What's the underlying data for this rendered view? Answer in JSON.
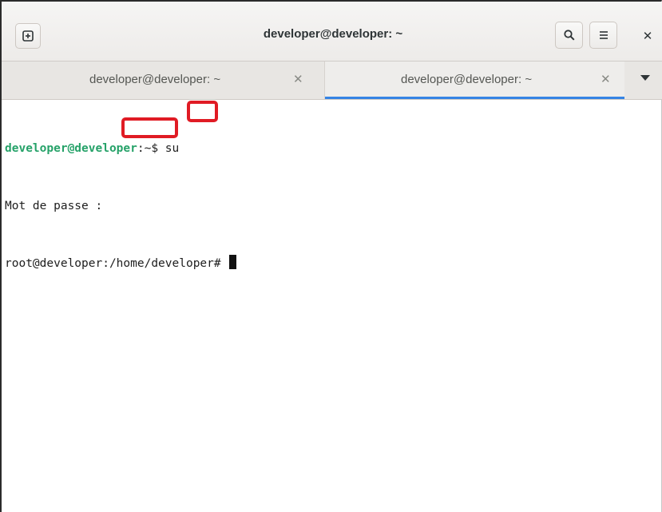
{
  "window": {
    "title": "developer@developer: ~"
  },
  "icons": {
    "new_tab": "new-tab-icon",
    "search": "search-icon",
    "menu": "hamburger-menu-icon",
    "close": "close-icon",
    "tab_close": "close-icon",
    "tab_list": "chevron-down-icon"
  },
  "tabs": [
    {
      "label": "developer@developer: ~",
      "active": false
    },
    {
      "label": "developer@developer: ~",
      "active": true
    }
  ],
  "terminal": {
    "line1": {
      "user_host": "developer@developer",
      "path_and_symbol": ":~$ ",
      "command": "su"
    },
    "line2": "Mot de passe : ",
    "line3": "root@developer:/home/developer# "
  },
  "colors": {
    "prompt_green": "#26a269",
    "accent_blue": "#3584e4",
    "highlight_red": "#e01b24"
  }
}
